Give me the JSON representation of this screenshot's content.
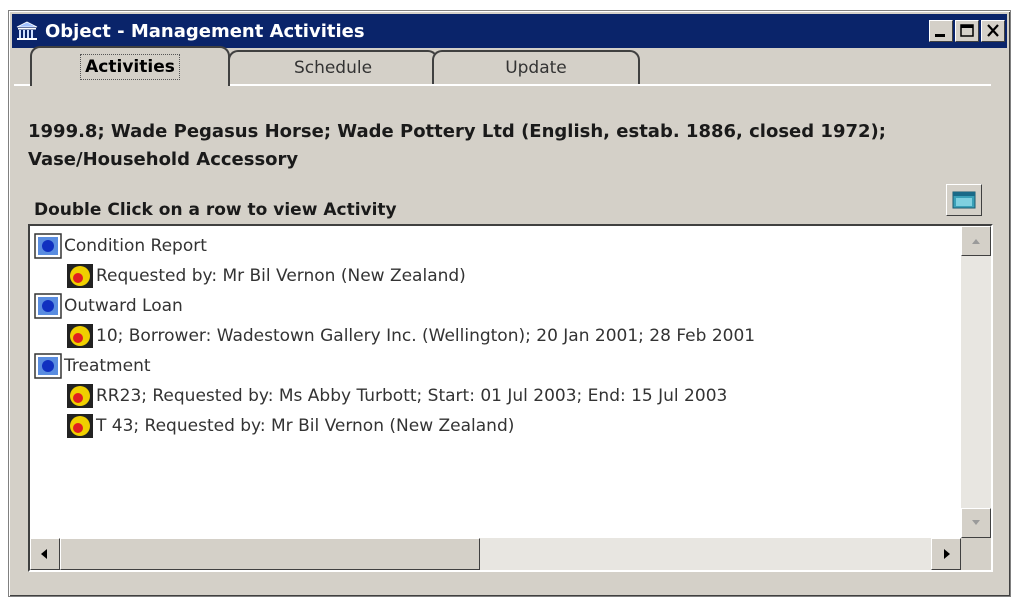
{
  "window": {
    "title": "Object - Management Activities",
    "title_icon": "museum-icon",
    "controls": [
      "minimize-icon",
      "maximize-icon",
      "close-icon"
    ]
  },
  "tabs": [
    {
      "label": "Activities",
      "active": true
    },
    {
      "label": "Schedule",
      "active": false
    },
    {
      "label": "Update",
      "active": false
    }
  ],
  "object_title": "1999.8; Wade Pegasus Horse; Wade Pottery Ltd (English, estab. 1886, closed 1972); Vase/Household Accessory",
  "instruction": "Double Click on a row to view Activity",
  "activity_tree": [
    {
      "label": "Condition Report",
      "icon": "activity-icon",
      "level": 0
    },
    {
      "label": "Requested by: Mr Bil Vernon (New Zealand)",
      "icon": "request-icon",
      "level": 1
    },
    {
      "label": "Outward Loan",
      "icon": "activity-icon",
      "level": 0
    },
    {
      "label": "10; Borrower: Wadestown Gallery Inc. (Wellington); 20 Jan 2001; 28 Feb 2001",
      "icon": "request-icon",
      "level": 1
    },
    {
      "label": "Treatment",
      "icon": "activity-icon",
      "level": 0
    },
    {
      "label": "RR23; Requested by: Ms Abby Turbott; Start: 01 Jul 2003; End: 15 Jul 2003",
      "icon": "request-icon",
      "level": 1
    },
    {
      "label": "T 43; Requested by: Mr Bil Vernon (New Zealand)",
      "icon": "request-icon",
      "level": 1
    }
  ],
  "colors": {
    "titlebar": "#0a246a",
    "window_bg": "#d4d0c8",
    "activity_icon": "#1e5adc",
    "request_icon": "#f0d000",
    "request_dot": "#e02020"
  }
}
